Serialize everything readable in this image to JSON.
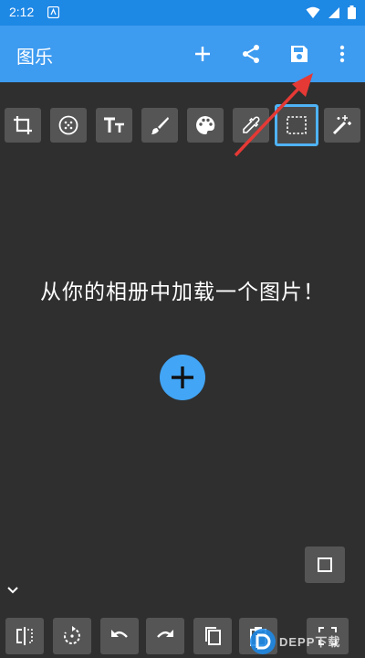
{
  "status_bar": {
    "time": "2:12"
  },
  "app_bar": {
    "title": "图乐"
  },
  "main": {
    "empty_message": "从你的相册中加载一个图片！"
  },
  "watermark": {
    "text": "DEPP下载"
  },
  "colors": {
    "app_bar": "#3d9bf0",
    "status_bar": "#1e88e5",
    "canvas": "#2f2f2f",
    "tool_button": "#555555",
    "selected_border": "#4fb3f6",
    "fab": "#42a5f5",
    "annotation_arrow": "#e53935"
  },
  "toolbar_icons": [
    "crop-icon",
    "blur-icon",
    "text-icon",
    "brush-icon",
    "palette-icon",
    "eyedropper-icon",
    "selection-icon",
    "magic-wand-icon"
  ],
  "bottom_icons": [
    "compare-icon",
    "rotate-icon",
    "undo-icon",
    "redo-icon",
    "copy-icon",
    "paste-icon",
    "fullscreen-icon"
  ]
}
